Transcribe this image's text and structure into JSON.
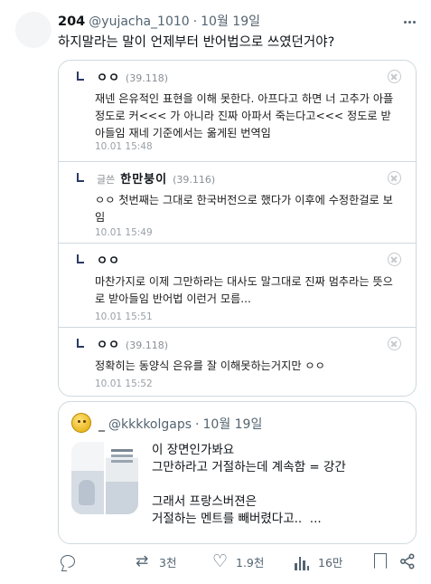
{
  "post": {
    "display_name": "204",
    "handle": "@yujacha_1010",
    "separator": "·",
    "date": "10월 19일",
    "text": "하지말라는 말이 언제부터 반어법으로 쓰였던거야?"
  },
  "quoted_comments": [
    {
      "prefix": "",
      "name": "ㅇㅇ",
      "ip": "(39.118)",
      "text": "재넨 은유적인 표현을 이해 못한다. 아프다고 하면 너 고추가 아플 정도로 커<<< 가 아니라 진짜 아파서 죽는다고<<< 정도로 받아들임 재네 기준에서는 옮게된 번역임",
      "time": "10.01 15:48"
    },
    {
      "prefix": "글쓴",
      "name": "한만붕이",
      "ip": "(39.116)",
      "text": "ㅇㅇ 첫번째는 그대로 한국버전으로 했다가 이후에 수정한걸로 보임",
      "time": "10.01 15:49"
    },
    {
      "prefix": "",
      "name": "ㅇㅇ",
      "ip": "",
      "text": "마찬가지로 이제 그만하라는 대사도 말그대로 진짜 멈추라는 뜻으로 받아들임 반어법 이런거 모름...",
      "time": "10.01 15:51"
    },
    {
      "prefix": "",
      "name": "ㅇㅇ",
      "ip": "(39.118)",
      "text": "정확히는 동양식 은유를 잘 이해못하는거지만 ㅇㅇ",
      "time": "10.01 15:52"
    }
  ],
  "quote_tweet": {
    "name": "_",
    "handle": "@kkkkolgaps",
    "separator": "·",
    "date": "10월 19일",
    "text": "이 장면인가봐요\n그만하라고 거절하는데 계속함 = 강간\n\n그래서 프랑스버젼은\n거절하는 멘트를 빼버렸다고..  ..."
  },
  "actions": {
    "reply_count": "",
    "retweet_count": "3천",
    "like_count": "1.9천",
    "view_count": "16만"
  },
  "icons": {
    "more": "more-icon",
    "reply": "reply-icon",
    "retweet": "retweet-icon",
    "like": "heart-icon",
    "views": "views-icon",
    "bookmark": "bookmark-icon",
    "share": "share-icon"
  },
  "colors": {
    "text": "#0f1419",
    "muted": "#536471",
    "border": "#cfd9de"
  }
}
